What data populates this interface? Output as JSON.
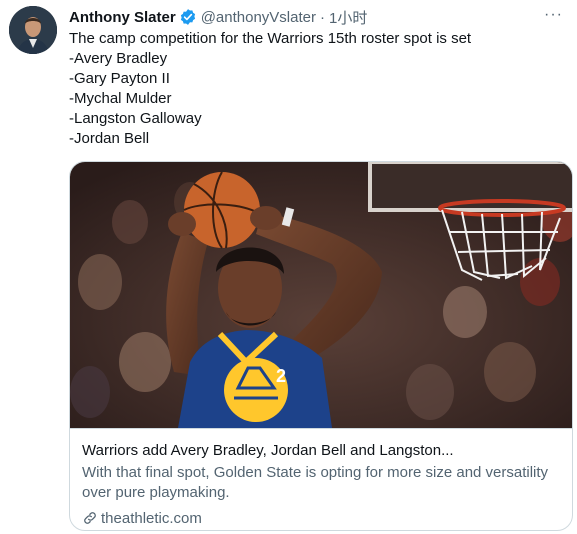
{
  "author": {
    "name": "Anthony Slater",
    "handle": "@anthonyVslater",
    "separator": "·",
    "time": "1小时"
  },
  "more_label": "···",
  "tweet_lines": [
    "The camp competition for the Warriors 15th roster spot is set",
    "-Avery Bradley",
    "-Gary Payton II",
    "-Mychal Mulder",
    "-Langston Galloway",
    "-Jordan Bell"
  ],
  "card": {
    "title": "Warriors add Avery Bradley, Jordan Bell and Langston...",
    "description": "With that final spot, Golden State is opting for more size and versatility over pure playmaking.",
    "domain": "theathletic.com",
    "jersey_number": "2"
  },
  "colors": {
    "verified": "#1d9bf0",
    "secondary_text": "#536471",
    "border": "#cfd9de",
    "jersey_blue": "#1d428a",
    "jersey_gold": "#ffc72c"
  },
  "icons": [
    "verified-badge-icon",
    "more-options-icon",
    "link-icon"
  ]
}
